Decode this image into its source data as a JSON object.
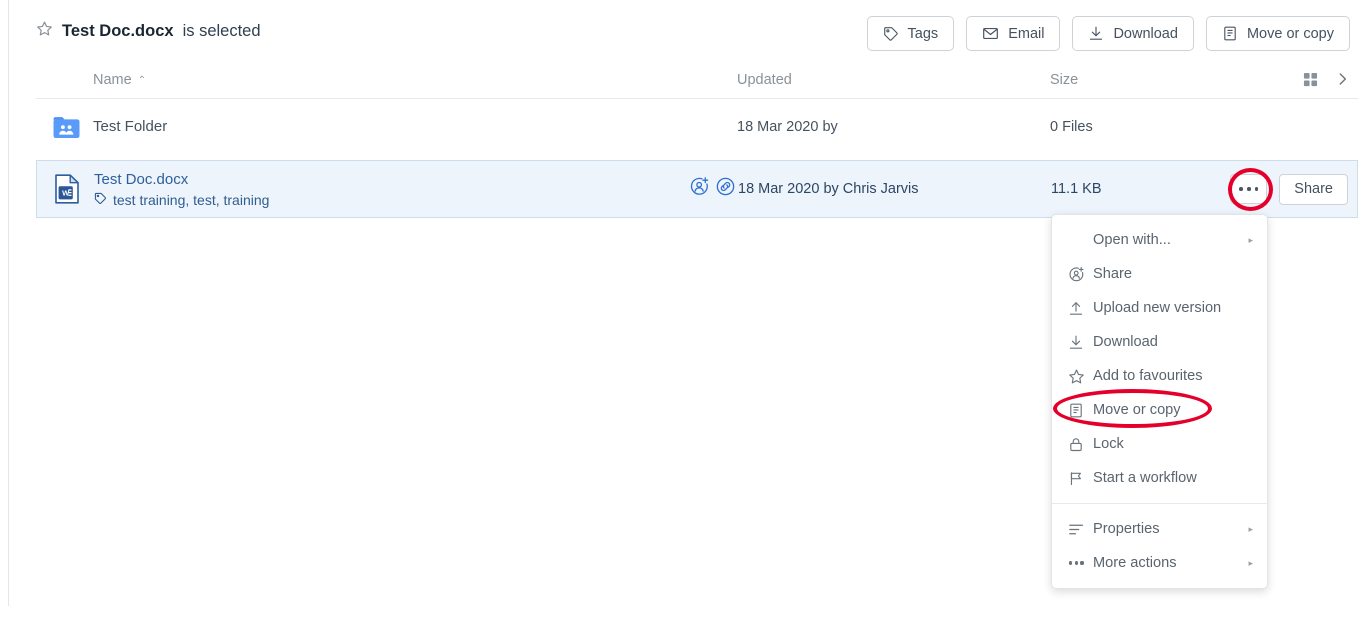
{
  "header": {
    "star_icon": "star-outline-icon",
    "selected_file": "Test Doc.docx",
    "selected_suffix": " is selected",
    "actions": [
      {
        "label": "Tags",
        "icon": "tag-icon"
      },
      {
        "label": "Email",
        "icon": "envelope-icon"
      },
      {
        "label": "Download",
        "icon": "download-icon"
      },
      {
        "label": "Move or copy",
        "icon": "copy-icon"
      }
    ]
  },
  "columns": {
    "name": "Name",
    "name_sort": "ascending",
    "sort_caret": "⌃",
    "updated": "Updated",
    "size": "Size",
    "view_toggle_icon": "grid-view-icon",
    "expand_icon": "chevron-right-icon"
  },
  "rows": [
    {
      "type": "folder",
      "icon": "shared-folder-icon",
      "name": "Test Folder",
      "tags": "",
      "updated": "18 Mar 2020 by",
      "size": "0 Files",
      "selected": false
    },
    {
      "type": "file",
      "icon": "word-doc-icon",
      "name": "Test Doc.docx",
      "tags_icon": "tag-icon",
      "tags": "test training, test, training",
      "updated": "18 Mar 2020 by Chris Jarvis",
      "size": "11.1 KB",
      "selected": true,
      "mini_icons": [
        "share-person-add-icon",
        "shared-link-icon"
      ],
      "more_button": "more-actions-icon",
      "share_label": "Share"
    }
  ],
  "context_menu": {
    "items": [
      {
        "label": "Open with...",
        "icon": "",
        "submenu": true
      },
      {
        "label": "Share",
        "icon": "share-person-add-icon",
        "submenu": false
      },
      {
        "label": "Upload new version",
        "icon": "upload-icon",
        "submenu": false
      },
      {
        "label": "Download",
        "icon": "download-icon",
        "submenu": false
      },
      {
        "label": "Add to favourites",
        "icon": "star-outline-icon",
        "submenu": false
      },
      {
        "label": "Move or copy",
        "icon": "copy-icon",
        "submenu": false
      },
      {
        "label": "Lock",
        "icon": "lock-icon",
        "submenu": false
      },
      {
        "label": "Start a workflow",
        "icon": "flag-icon",
        "submenu": false
      }
    ],
    "items_secondary": [
      {
        "label": "Properties",
        "icon": "list-lines-icon",
        "submenu": true
      },
      {
        "label": "More actions",
        "icon": "ellipsis-icon",
        "submenu": true
      }
    ],
    "submenu_arrow": "▸"
  },
  "annotations": {
    "highlight_color": "#E4002B",
    "circled_more_button": "more-actions-icon",
    "circled_menu_item": "Move or copy"
  }
}
